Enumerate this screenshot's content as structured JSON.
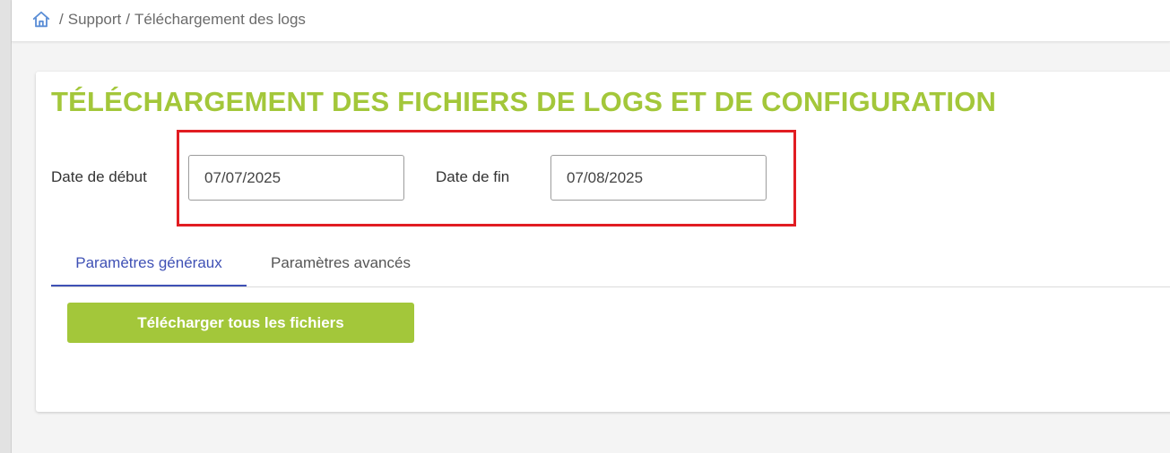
{
  "colors": {
    "accent_green": "#a3c73a",
    "tab_active": "#3f51b5",
    "highlight_red": "#e11d22"
  },
  "breadcrumb": {
    "home_icon": "home-icon",
    "items": [
      "Support",
      "Téléchargement des logs"
    ]
  },
  "page": {
    "title": "TÉLÉCHARGEMENT DES FICHIERS DE LOGS ET DE CONFIGURATION"
  },
  "form": {
    "start_label": "Date de début",
    "start_value": "07/07/2025",
    "end_label": "Date de fin",
    "end_value": "07/08/2025"
  },
  "tabs": [
    {
      "label": "Paramètres généraux",
      "active": true
    },
    {
      "label": "Paramètres avancés",
      "active": false
    }
  ],
  "actions": {
    "download_all_label": "Télécharger tous les fichiers"
  }
}
